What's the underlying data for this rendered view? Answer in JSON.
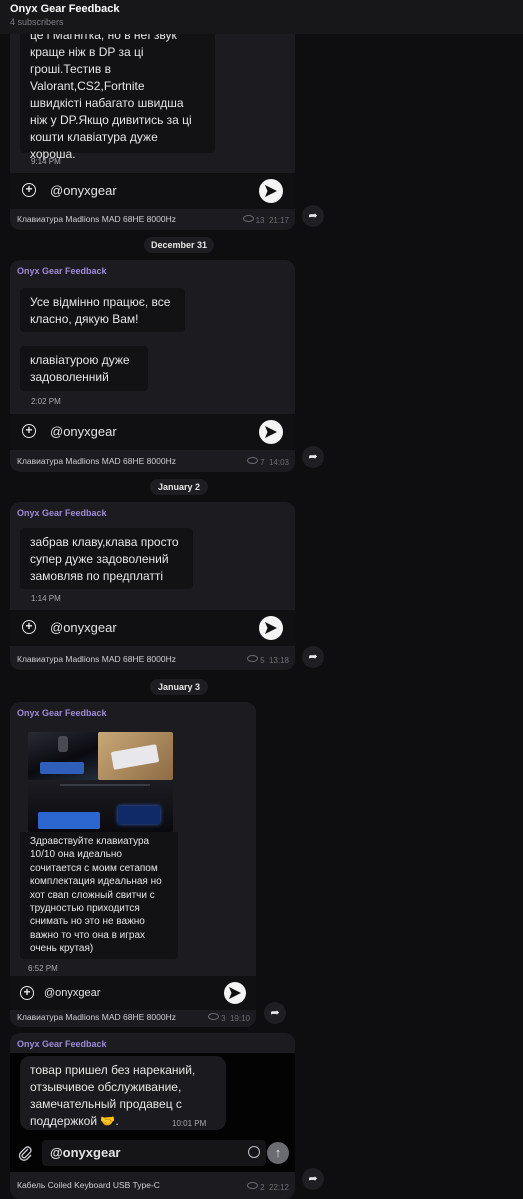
{
  "header": {
    "title": "Onyx Gear Feedback",
    "subscribers": "4 subscribers"
  },
  "posts": [
    {
      "message": "це і Магнітка, но в неї звук\nкраще ніж в DP за ці\nгроші.Тестив в\nValorant,CS2,Fortnite\nшвидкісті набагато швидша\nніж у DP.Якщо дивитись за ці\nкошти клавіатура дуже\nхороша.",
      "time": "9:14 PM",
      "handle": "@onyxgear",
      "product": "Клавиатура Madlions MAD 68HE 8000Hz",
      "views": "13",
      "post_time": "21:17"
    },
    {
      "sender": "Onyx Gear Feedback",
      "messages": [
        "Усе відмінно працює, все\nкласно, дякую Вам!",
        "клавіатурою дуже\nзадоволенний"
      ],
      "time": "2:02 PM",
      "handle": "@onyxgear",
      "product": "Клавиатура Madlions MAD 68HE 8000Hz",
      "views": "7",
      "post_time": "14:03"
    },
    {
      "sender": "Onyx Gear Feedback",
      "message": "забрав клаву,клава просто\nсупер дуже задоволений\nзамовляв по предплатті",
      "time": "1:14 PM",
      "handle": "@onyxgear",
      "product": "Клавиатура Madlions MAD 68HE 8000Hz",
      "views": "5",
      "post_time": "13:18"
    },
    {
      "sender": "Onyx Gear Feedback",
      "message": "Здравствуйте клавиатура\n10/10 она идеально\nсочитается с моим сетапом\nкомплектация идеальная но\nхот свап сложный свитчи с\nтрудностью приходится\nснимать но это не важно\nважно то что она в играх\nочень крутая)",
      "time": "6:52 PM",
      "handle": "@onyxgear",
      "product": "Клавиатура Madlions MAD 68HE 8000Hz",
      "views": "3",
      "post_time": "19:10"
    },
    {
      "sender": "Onyx Gear Feedback",
      "message": "товар пришел без нареканий,\nотзывчивое обслуживание,\nзамечательный продавец с\nподдержкой 🤝.",
      "time": "10:01 PM",
      "handle": "@onyxgear",
      "product": "Кабель Coiled Keyboard USB Type-C",
      "views": "2",
      "post_time": "22:12"
    }
  ],
  "dates": [
    "December 31",
    "January 2",
    "January 3"
  ],
  "colors": {
    "accent": "#9f8ad8",
    "background": "#0e0e10",
    "card": "#1c1c20"
  }
}
